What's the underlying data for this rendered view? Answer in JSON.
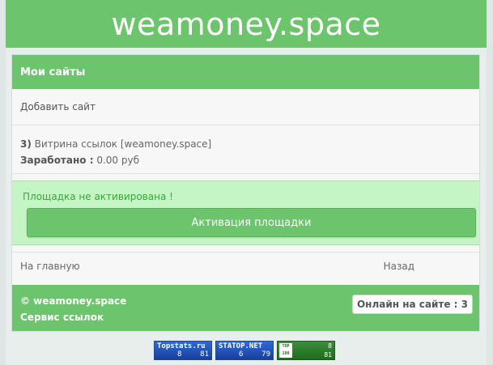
{
  "header": {
    "logo": "weamoney.space"
  },
  "panel": {
    "title": "Мои сайты",
    "add_site": "Добавить сайт",
    "site": {
      "number": "3)",
      "name": "Витрина ссылок [weamoney.space]",
      "earned_label": "Заработано :",
      "earned_value": "0.00 руб"
    },
    "alert": {
      "text": "Площадка не активирована !",
      "button": "Активация площадки"
    },
    "nav": {
      "home": "На главную",
      "back": "Назад"
    }
  },
  "footer": {
    "copyright": "© weamoney.space",
    "service": "Сервис ссылок",
    "online": "Онлайн на сайте : 3"
  },
  "counters": [
    {
      "name": "Topstats.ru",
      "v1": "8",
      "v2": "81"
    },
    {
      "name": "STATOP.NET",
      "v1": "6",
      "v2": "79"
    },
    {
      "name": "TOP 100",
      "v1": "8",
      "v2": "81"
    }
  ],
  "colors": {
    "brand_green": "#6cc56c",
    "alert_bg": "#c5f5c5",
    "alert_text": "#3aa63a"
  }
}
